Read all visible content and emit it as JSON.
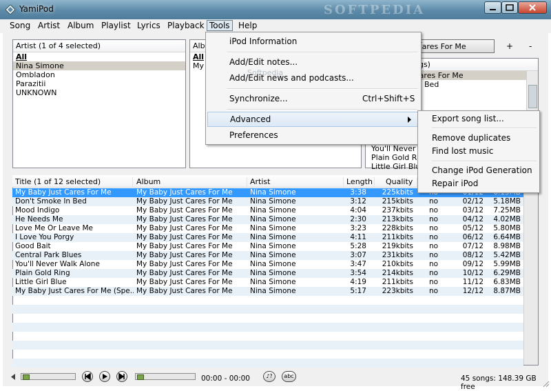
{
  "window": {
    "title": "YamiPod",
    "watermark": "SOFTPEDIA"
  },
  "menubar": [
    "Song",
    "Artist",
    "Album",
    "Playlist",
    "Lyrics",
    "Playback",
    "Tools",
    "Help"
  ],
  "artist_panel": {
    "header": "Artist (1 of 4 selected)",
    "items": [
      "All",
      "Nina Simone",
      "Ombladon",
      "Parazitii",
      "UNKNOWN"
    ]
  },
  "album_panel": {
    "header_partial": "Albu",
    "items_partial": [
      "All",
      "My"
    ]
  },
  "playlist_panel": {
    "combo_value": "Cares For Me",
    "add_label": "+",
    "remove_label": "-",
    "header_partial": "ngs)",
    "items_top": [
      "Cares For Me",
      "Bed"
    ],
    "items_bottom": [
      "You'll Never W",
      "Plain Gold Ring",
      "Little Girl Blue"
    ]
  },
  "tools_menu": {
    "items": [
      "iPod Information",
      "Add/Edit notes...",
      "Add/Edit news and podcasts...",
      "Synchronize...",
      "Advanced",
      "Preferences"
    ],
    "shortcut": "Ctrl+Shift+S",
    "overlay_text": "Softpedia"
  },
  "advanced_menu": [
    "Export song list...",
    "Remove duplicates",
    "Find lost music",
    "Change iPod Generation",
    "Repair iPod"
  ],
  "songs": {
    "headers": [
      "Title (1 of 12 selected)",
      "Album",
      "Artist",
      "Length",
      "Quality"
    ],
    "rows": [
      {
        "title": "My Baby Just Cares For Me",
        "album": "My Baby Just Cares For Me",
        "artist": "Nina Simone",
        "length": "3:38",
        "quality": "225kbits",
        "flag": "no",
        "track": "01/12",
        "size": "6.15MB"
      },
      {
        "title": "Don't Smoke In Bed",
        "album": "My Baby Just Cares For Me",
        "artist": "Nina Simone",
        "length": "3:12",
        "quality": "215kbits",
        "flag": "no",
        "track": "02/12",
        "size": "5.18MB"
      },
      {
        "title": "Mood Indigo",
        "album": "My Baby Just Cares For Me",
        "artist": "Nina Simone",
        "length": "4:04",
        "quality": "237kbits",
        "flag": "no",
        "track": "03/12",
        "size": "7.25MB"
      },
      {
        "title": "He Needs Me",
        "album": "My Baby Just Cares For Me",
        "artist": "Nina Simone",
        "length": "2:30",
        "quality": "213kbits",
        "flag": "no",
        "track": "04/12",
        "size": "4.02MB"
      },
      {
        "title": "Love Me Or Leave Me",
        "album": "My Baby Just Cares For Me",
        "artist": "Nina Simone",
        "length": "3:23",
        "quality": "228kbits",
        "flag": "no",
        "track": "05/12",
        "size": "5.80MB"
      },
      {
        "title": "I Love You Porgy",
        "album": "My Baby Just Cares For Me",
        "artist": "Nina Simone",
        "length": "4:11",
        "quality": "211kbits",
        "flag": "no",
        "track": "06/12",
        "size": "6.64MB"
      },
      {
        "title": "Good Bait",
        "album": "My Baby Just Cares For Me",
        "artist": "Nina Simone",
        "length": "5:28",
        "quality": "219kbits",
        "flag": "no",
        "track": "07/12",
        "size": "8.98MB"
      },
      {
        "title": "Central Park Blues",
        "album": "My Baby Just Cares For Me",
        "artist": "Nina Simone",
        "length": "3:07",
        "quality": "231kbits",
        "flag": "no",
        "track": "08/12",
        "size": "5.42MB"
      },
      {
        "title": "You'll Never Walk Alone",
        "album": "My Baby Just Cares For Me",
        "artist": "Nina Simone",
        "length": "3:47",
        "quality": "210kbits",
        "flag": "no",
        "track": "09/12",
        "size": "5.99MB"
      },
      {
        "title": "Plain Gold Ring",
        "album": "My Baby Just Cares For Me",
        "artist": "Nina Simone",
        "length": "3:54",
        "quality": "214kbits",
        "flag": "no",
        "track": "10/12",
        "size": "6.29MB"
      },
      {
        "title": "Little Girl Blue",
        "album": "My Baby Just Cares For Me",
        "artist": "Nina Simone",
        "length": "4:19",
        "quality": "211kbits",
        "flag": "no",
        "track": "11/12",
        "size": "6.83MB"
      },
      {
        "title": "My Baby Just Cares For Me (Spe...",
        "album": "My Baby Just Cares For Me",
        "artist": "Nina Simone",
        "length": "5:17",
        "quality": "223kbits",
        "flag": "no",
        "track": "12/12",
        "size": "8.87MB"
      }
    ]
  },
  "player": {
    "time": "00:00 - 00:00",
    "lyrics_btn": "♪?",
    "abc_btn": "abc",
    "status": "45 songs:  148.39 GB free"
  }
}
